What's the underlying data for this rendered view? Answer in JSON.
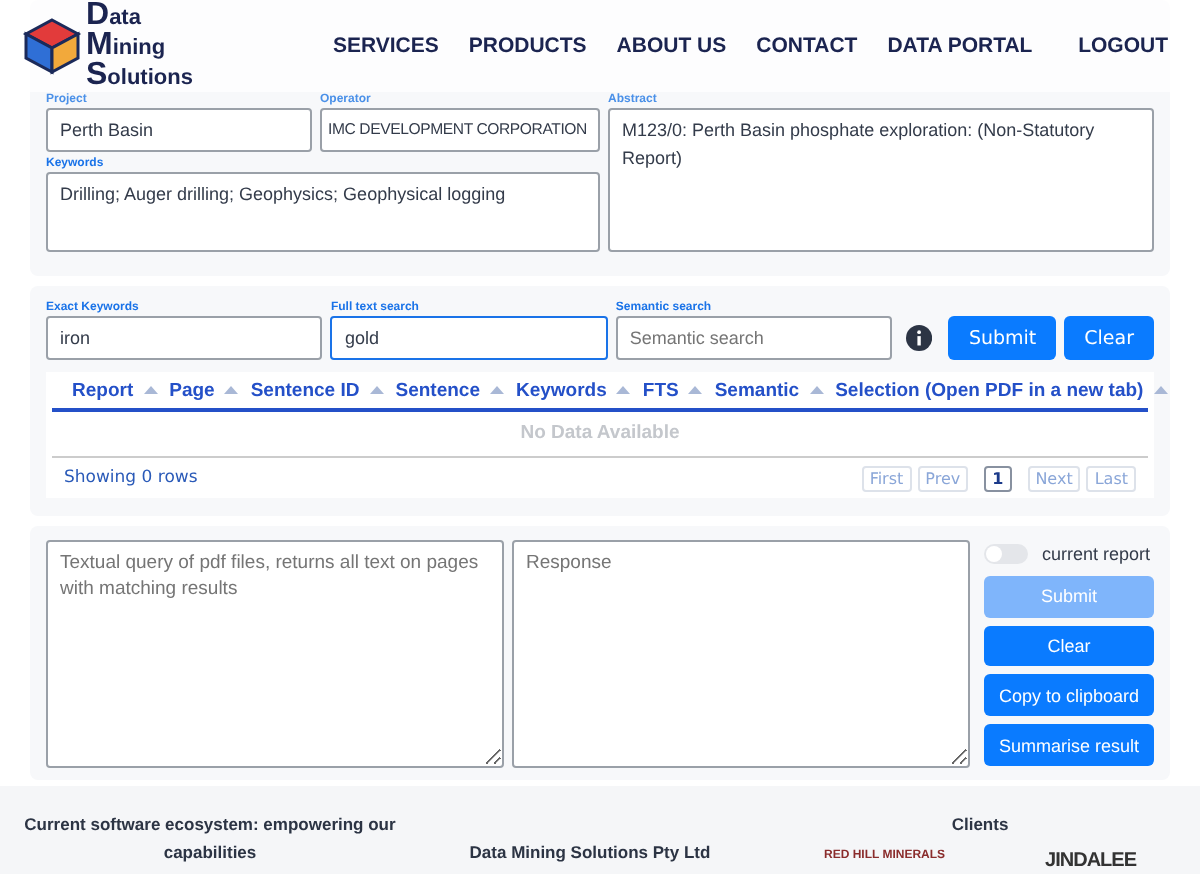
{
  "nav": {
    "logo": [
      "Data",
      "Mining",
      "Solutions"
    ],
    "links": [
      "SERVICES",
      "PRODUCTS",
      "ABOUT US",
      "CONTACT",
      "DATA PORTAL"
    ],
    "logout": "LOGOUT"
  },
  "details": {
    "project": {
      "label": "Project",
      "value": "Perth Basin"
    },
    "operator": {
      "label": "Operator",
      "value": "IMC DEVELOPMENT CORPORATION"
    },
    "abstract": {
      "label": "Abstract",
      "value": "M123/0: Perth Basin phosphate exploration: (Non-Statutory Report)"
    },
    "keywords": {
      "label": "Keywords",
      "value": "Drilling; Auger drilling; Geophysics; Geophysical logging"
    }
  },
  "search": {
    "fields": [
      {
        "label": "Exact Keywords",
        "value": "iron",
        "focused": false
      },
      {
        "label": "Full text search",
        "value": "gold",
        "focused": true
      },
      {
        "label": "Semantic search",
        "placeholder": "Semantic search",
        "focused": false
      }
    ],
    "submit": "Submit",
    "clear": "Clear"
  },
  "table": {
    "columns": [
      "Report",
      "Page",
      "Sentence ID",
      "Sentence",
      "Keywords",
      "FTS",
      "Semantic",
      "Selection (Open PDF in a new tab)"
    ],
    "empty": "No Data Available",
    "status": "Showing 0 rows",
    "pager": [
      {
        "label": "First",
        "selected": false
      },
      {
        "label": "Prev",
        "selected": false
      },
      {
        "label": "1",
        "selected": true
      },
      {
        "label": "Next",
        "selected": false
      },
      {
        "label": "Last",
        "selected": false
      }
    ]
  },
  "query": {
    "placeholder": "Textual query of pdf files, returns all text on pages with matching results",
    "response_placeholder": "Response",
    "toggle": {
      "label": "current report",
      "on": false
    },
    "buttons": [
      {
        "label": "Submit",
        "disabled": true
      },
      {
        "label": "Clear",
        "disabled": false
      },
      {
        "label": "Copy to clipboard",
        "disabled": false
      },
      {
        "label": "Summarise result",
        "disabled": false
      }
    ]
  },
  "footer": {
    "ecosystem": "Current software ecosystem: empowering our capabilities",
    "company": "Data Mining Solutions Pty Ltd",
    "clients": "Clients",
    "client_logos": [
      "RED HILL MINERALS",
      "JINDALEE"
    ]
  }
}
